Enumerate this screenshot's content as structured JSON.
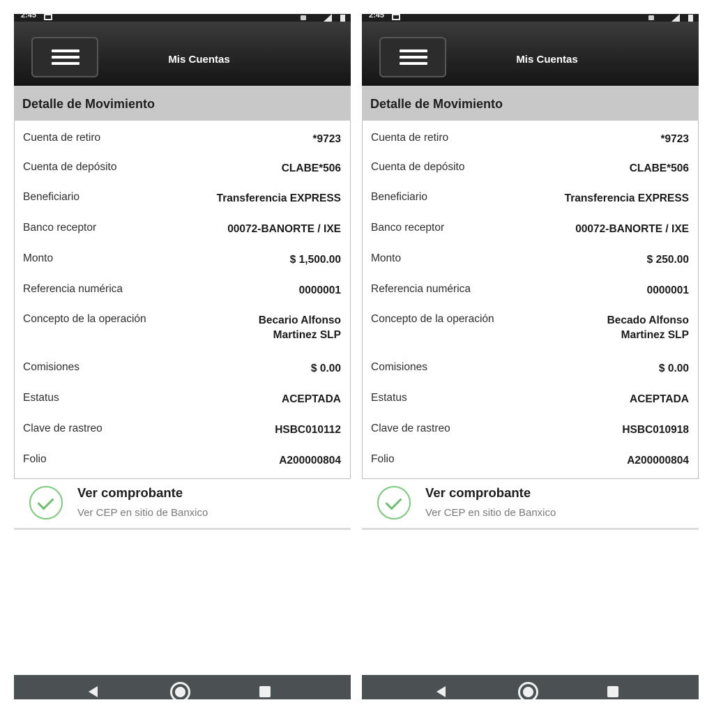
{
  "screens": [
    {
      "status_time": "2:45",
      "header_title": "Mis Cuentas",
      "section_title": "Detalle de Movimiento",
      "rows": [
        {
          "label": "Cuenta de retiro",
          "value": "*9723"
        },
        {
          "label": "Cuenta de depósito",
          "value": "CLABE*506"
        },
        {
          "label": "Beneficiario",
          "value": "Transferencia EXPRESS"
        },
        {
          "label": "Banco receptor",
          "value": "00072-BANORTE / IXE"
        },
        {
          "label": "Monto",
          "value": "$ 1,500.00"
        },
        {
          "label": "Referencia numérica",
          "value": "0000001"
        },
        {
          "label": "Concepto de la operación",
          "value": "Becario Alfonso\nMartinez SLP"
        },
        {
          "label": "Comisiones",
          "value": "$ 0.00"
        },
        {
          "label": "Estatus",
          "value": "ACEPTADA"
        },
        {
          "label": "Clave de rastreo",
          "value": "HSBC010112"
        },
        {
          "label": "Folio",
          "value": "A200000804"
        }
      ],
      "receipt": {
        "title": "Ver comprobante",
        "subtitle": "Ver CEP en sitio de Banxico"
      }
    },
    {
      "status_time": "2:45",
      "header_title": "Mis Cuentas",
      "section_title": "Detalle de Movimiento",
      "rows": [
        {
          "label": "Cuenta de retiro",
          "value": "*9723"
        },
        {
          "label": "Cuenta de depósito",
          "value": "CLABE*506"
        },
        {
          "label": "Beneficiario",
          "value": "Transferencia EXPRESS"
        },
        {
          "label": "Banco receptor",
          "value": "00072-BANORTE / IXE"
        },
        {
          "label": "Monto",
          "value": "$ 250.00"
        },
        {
          "label": "Referencia numérica",
          "value": "0000001"
        },
        {
          "label": "Concepto de la operación",
          "value": "Becado Alfonso\nMartinez SLP"
        },
        {
          "label": "Comisiones",
          "value": "$ 0.00"
        },
        {
          "label": "Estatus",
          "value": "ACEPTADA"
        },
        {
          "label": "Clave de rastreo",
          "value": "HSBC010918"
        },
        {
          "label": "Folio",
          "value": "A200000804"
        }
      ],
      "receipt": {
        "title": "Ver comprobante",
        "subtitle": "Ver CEP en sitio de Banxico"
      }
    }
  ],
  "icons": {
    "menu": "hamburger-icon",
    "receipt": "check-circle-icon",
    "status_image": "image-icon",
    "nav_back": "back-triangle-icon",
    "nav_home": "home-circle-icon",
    "nav_recent": "recent-apps-square-icon"
  },
  "colors": {
    "header_bg": "#1f1f1f",
    "section_header_bg": "#c8c8c8",
    "check_green": "#7dc97d",
    "nav_bar_bg": "#4b5152"
  }
}
